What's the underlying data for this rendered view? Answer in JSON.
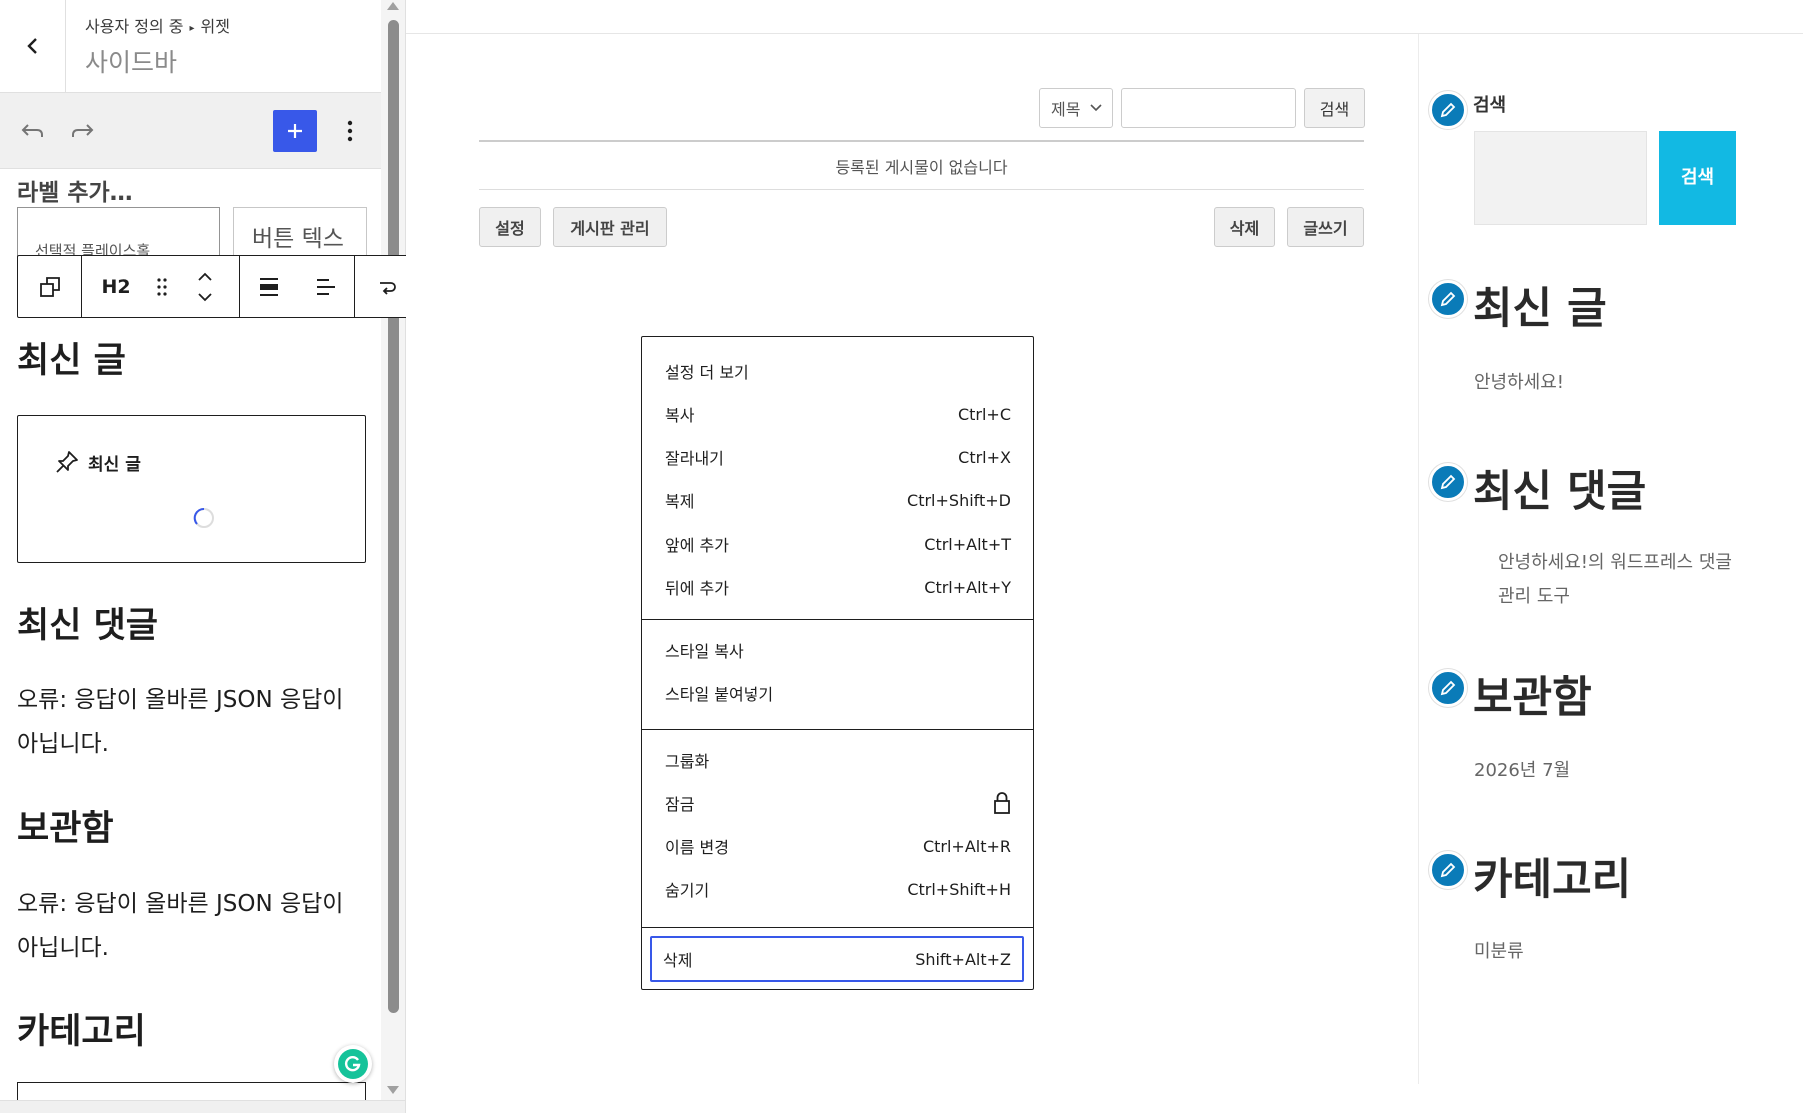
{
  "sidebar": {
    "breadcrumb": {
      "part1": "사용자 정의 중",
      "separator": "▸",
      "part2": "위젯"
    },
    "title": "사이드바",
    "label_add": "라벨 추가…",
    "search_placeholder_box": "선택적 플레이스홀",
    "button_text_box": "버튼 텍스",
    "heading_latest_posts": "최신 글",
    "latest_posts_placeholder_label": "최신 글",
    "heading_latest_comments": "최신 댓글",
    "error_comments": "오류: 응답이 올바른 JSON 응답이 아닙니다.",
    "heading_archive": "보관함",
    "error_archive": "오류: 응답이 올바른 JSON 응답이 아닙니다.",
    "heading_category": "카테고리"
  },
  "block_toolbar": {
    "heading_level": "H2"
  },
  "board": {
    "select_value": "제목",
    "search_button": "검색",
    "empty_message": "등록된 게시물이 없습니다",
    "settings_button": "설정",
    "manage_button": "게시판 관리",
    "delete_button": "삭제",
    "write_button": "글쓰기"
  },
  "dropdown": {
    "sections": [
      [
        {
          "label": "설정 더 보기",
          "shortcut": ""
        },
        {
          "label": "복사",
          "shortcut": "Ctrl+C"
        },
        {
          "label": "잘라내기",
          "shortcut": "Ctrl+X"
        },
        {
          "label": "복제",
          "shortcut": "Ctrl+Shift+D"
        },
        {
          "label": "앞에 추가",
          "shortcut": "Ctrl+Alt+T"
        },
        {
          "label": "뒤에 추가",
          "shortcut": "Ctrl+Alt+Y"
        }
      ],
      [
        {
          "label": "스타일 복사",
          "shortcut": ""
        },
        {
          "label": "스타일 붙여넣기",
          "shortcut": ""
        }
      ],
      [
        {
          "label": "그룹화",
          "shortcut": ""
        },
        {
          "label": "잠금",
          "shortcut": ""
        },
        {
          "label": "이름 변경",
          "shortcut": "Ctrl+Alt+R"
        },
        {
          "label": "숨기기",
          "shortcut": "Ctrl+Shift+H"
        }
      ],
      [
        {
          "label": "삭제",
          "shortcut": "Shift+Alt+Z"
        }
      ]
    ]
  },
  "widgets": {
    "search_title": "검색",
    "search_button_line1": "검",
    "search_button_line2": "색",
    "latest_posts_title": "최신 글",
    "latest_post_item": "안녕하세요!",
    "latest_comments_title": "최신 댓글",
    "latest_comment_item": "안녕하세요!의 워드프레스 댓글 관리 도구",
    "archive_title": "보관함",
    "archive_item": "2026년 7월",
    "category_title": "카테고리",
    "category_item": "미분류"
  },
  "colors": {
    "accent": "#3858e9",
    "edit_pencil": "#0a7bb8",
    "search_button": "#12b9e3"
  }
}
